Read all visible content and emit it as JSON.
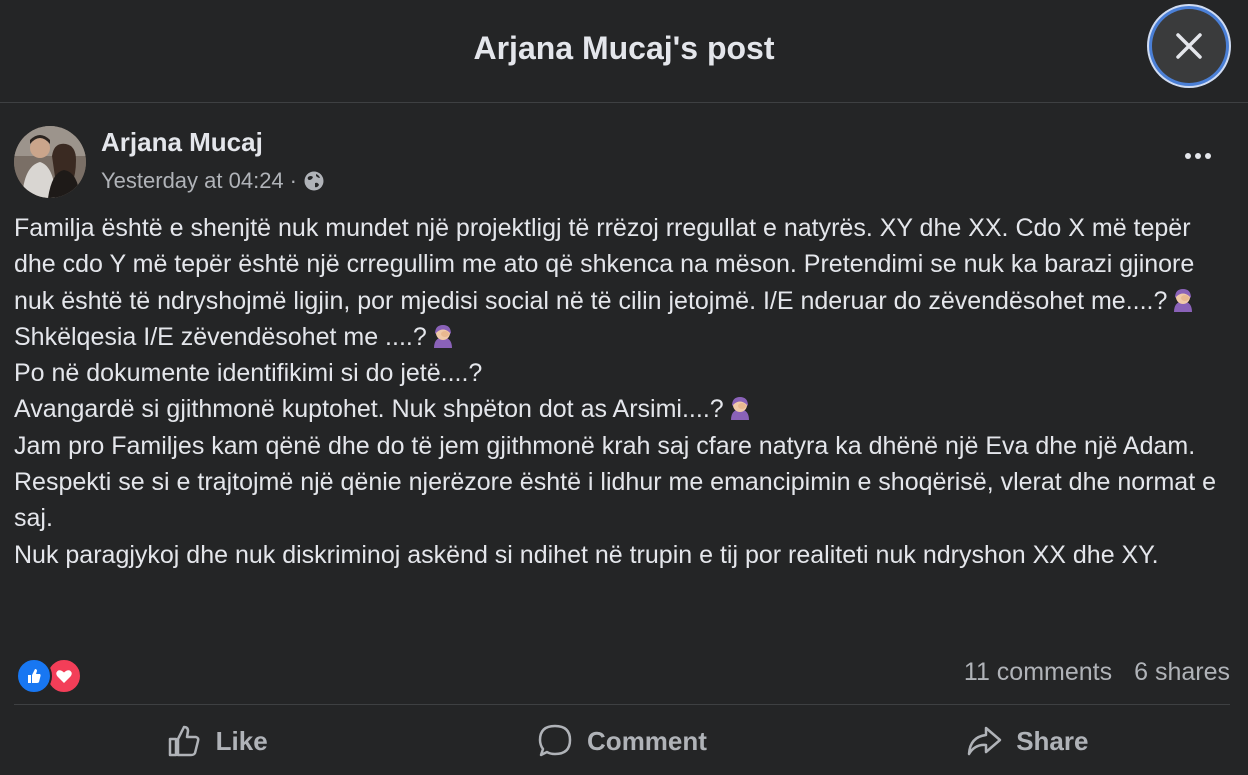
{
  "header": {
    "title": "Arjana Mucaj's post"
  },
  "post": {
    "author": "Arjana Mucaj",
    "timestamp": "Yesterday at 04:24",
    "separator": "·",
    "audience_icon": "globe-icon",
    "paragraphs": [
      "Familja është e shenjtë nuk mundet një projektligj të rrëzoj rregullat e natyrës. XY dhe XX. Cdo X më tepër dhe cdo Y më tepër është një crregullim me ato që shkenca na mëson. Pretendimi se nuk ka barazi gjinore nuk është të ndryshojmë ligjin, por mjedisi social në të cilin jetojmë. I/E nderuar do zëvendësohet me....?",
      "Shkëlqesia I/E zëvendësohet me ....?",
      "Po në dokumente identifikimi si do jetë....?",
      "Avangardë si gjithmonë kuptohet. Nuk shpëton dot as Arsimi....?",
      "Jam pro Familjes kam qënë dhe do të jem gjithmonë krah saj cfare natyra ka dhënë një Eva dhe një Adam. Respekti se si e trajtojmë një qënie njerëzore është i lidhur me emancipimin e shoqërisë, vlerat dhe normat e saj.",
      "Nuk paragjykoj dhe nuk diskriminoj askënd si ndihet në trupin e tij por realiteti nuk ndryshon XX dhe XY."
    ],
    "emoji_icon": "woman-facepalming-emoji"
  },
  "stats": {
    "reactions": [
      "like-reaction-icon",
      "love-reaction-icon"
    ],
    "comments": "11 comments",
    "shares": "6 shares"
  },
  "actions": {
    "like": "Like",
    "comment": "Comment",
    "share": "Share"
  },
  "colors": {
    "background": "#242526",
    "text_primary": "#e4e6eb",
    "text_secondary": "#b0b3b8",
    "like_blue": "#1877f2",
    "love_red": "#f33e58",
    "close_ring": "#4a7fd6"
  }
}
